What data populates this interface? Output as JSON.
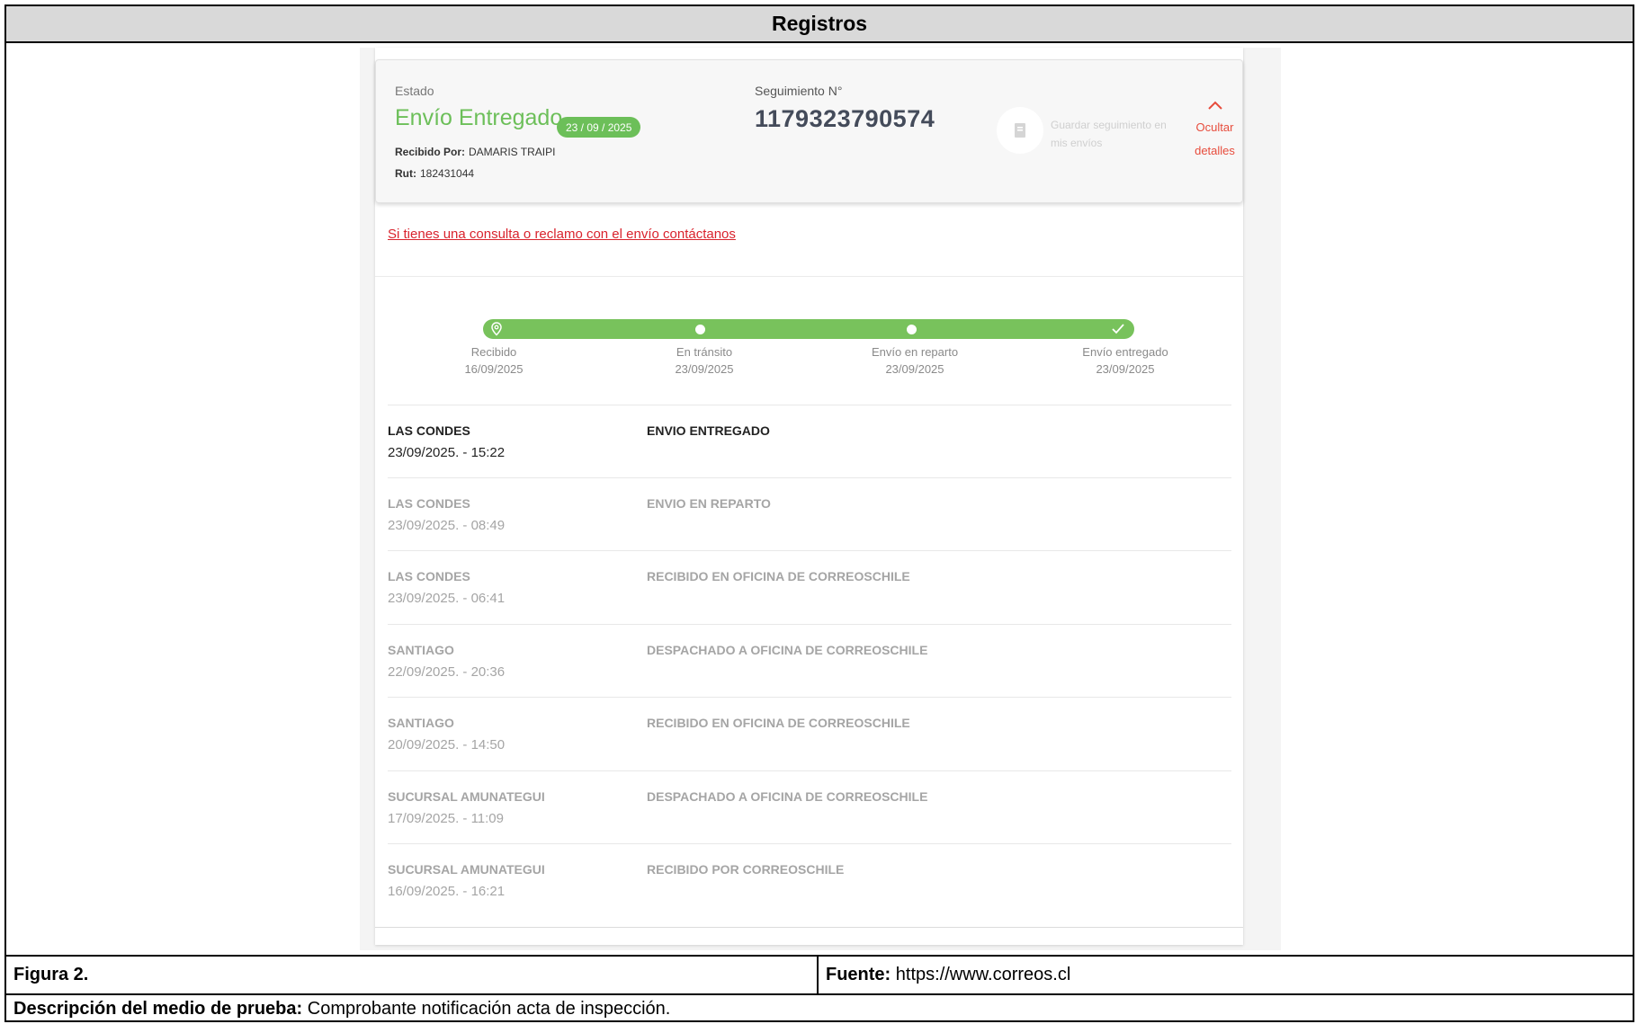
{
  "document": {
    "title": "Registros",
    "figure_label": "Figura 2.",
    "source_label": "Fuente:",
    "source_value": "https://www.correos.cl",
    "description_label": "Descripción del medio de prueba:",
    "description_value": "Comprobante notificación acta de inspección."
  },
  "tracking": {
    "estado_label": "Estado",
    "estado_value": "Envío Entregado",
    "estado_date": "23 / 09 / 2025",
    "recibido_por_label": "Recibido Por:",
    "recibido_por_value": "DAMARIS TRAIPI",
    "rut_label": "Rut:",
    "rut_value": "182431044",
    "seguimiento_label": "Seguimiento N°",
    "seguimiento_value": "1179323790574",
    "save_text": "Guardar seguimiento en mis envíos",
    "hide_label_1": "Ocultar",
    "hide_label_2": "detalles",
    "contact_link": "Si tienes una consulta o reclamo con el envío contáctanos",
    "accent_color": "#6cbf59",
    "link_color": "#d9232d"
  },
  "progress_steps": [
    {
      "label": "Recibido",
      "date": "16/09/2025"
    },
    {
      "label": "En tránsito",
      "date": "23/09/2025"
    },
    {
      "label": "Envío en reparto",
      "date": "23/09/2025"
    },
    {
      "label": "Envío entregado",
      "date": "23/09/2025"
    }
  ],
  "events": [
    {
      "location": "LAS CONDES",
      "datetime": "23/09/2025. - 15:22",
      "description": "ENVIO ENTREGADO"
    },
    {
      "location": "LAS CONDES",
      "datetime": "23/09/2025. - 08:49",
      "description": "ENVIO EN REPARTO"
    },
    {
      "location": "LAS CONDES",
      "datetime": "23/09/2025. - 06:41",
      "description": "RECIBIDO EN OFICINA DE CORREOSCHILE"
    },
    {
      "location": "SANTIAGO",
      "datetime": "22/09/2025. - 20:36",
      "description": "DESPACHADO A OFICINA DE CORREOSCHILE"
    },
    {
      "location": "SANTIAGO",
      "datetime": "20/09/2025. - 14:50",
      "description": "RECIBIDO EN OFICINA DE CORREOSCHILE"
    },
    {
      "location": "SUCURSAL AMUNATEGUI",
      "datetime": "17/09/2025. - 11:09",
      "description": "DESPACHADO A OFICINA DE CORREOSCHILE"
    },
    {
      "location": "SUCURSAL AMUNATEGUI",
      "datetime": "16/09/2025. - 16:21",
      "description": "RECIBIDO POR CORREOSCHILE"
    }
  ]
}
